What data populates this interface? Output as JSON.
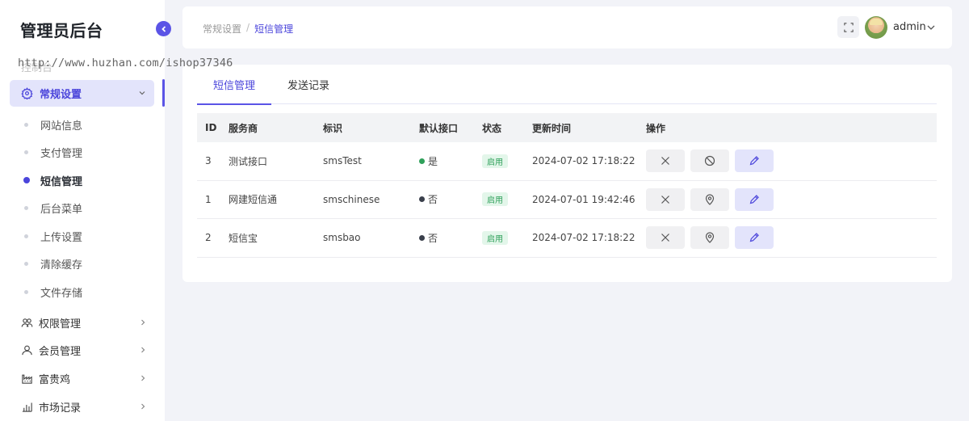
{
  "app": {
    "title": "管理员后台"
  },
  "watermark": "http://www.huzhan.com/ishop37346",
  "sidebar": {
    "ghost_item": "控制台",
    "active_group": {
      "label": "常规设置",
      "icon": "gear-icon"
    },
    "submenu": [
      {
        "label": "网站信息",
        "active": false
      },
      {
        "label": "支付管理",
        "active": false
      },
      {
        "label": "短信管理",
        "active": true
      },
      {
        "label": "后台菜单",
        "active": false
      },
      {
        "label": "上传设置",
        "active": false
      },
      {
        "label": "清除缓存",
        "active": false
      },
      {
        "label": "文件存储",
        "active": false
      }
    ],
    "groups": [
      {
        "label": "权限管理",
        "icon": "users-icon"
      },
      {
        "label": "会员管理",
        "icon": "user-icon"
      },
      {
        "label": "富贵鸡",
        "icon": "factory-icon"
      },
      {
        "label": "市场记录",
        "icon": "bar-chart-icon"
      }
    ]
  },
  "header": {
    "breadcrumb": [
      "常规设置",
      "短信管理"
    ],
    "breadcrumb_sep": "/",
    "username": "admin"
  },
  "tabs": [
    {
      "label": "短信管理",
      "active": true
    },
    {
      "label": "发送记录",
      "active": false
    }
  ],
  "table": {
    "columns": [
      "ID",
      "服务商",
      "标识",
      "默认接口",
      "状态",
      "更新时间",
      "操作"
    ],
    "rows": [
      {
        "id": "3",
        "provider": "测试接口",
        "tag": "smsTest",
        "default": "是",
        "default_color": "#2fa05a",
        "status": "启用",
        "updated": "2024-07-02 17:18:22",
        "mid_icon": "ban-icon"
      },
      {
        "id": "1",
        "provider": "网建短信通",
        "tag": "smschinese",
        "default": "否",
        "default_color": "#3a3f4b",
        "status": "启用",
        "updated": "2024-07-01 19:42:46",
        "mid_icon": "location-icon"
      },
      {
        "id": "2",
        "provider": "短信宝",
        "tag": "smsbao",
        "default": "否",
        "default_color": "#3a3f4b",
        "status": "启用",
        "updated": "2024-07-02 17:18:22",
        "mid_icon": "location-icon"
      }
    ]
  },
  "colors": {
    "accent": "#5b54e6",
    "active_bg": "#e3e4fb",
    "success": "#2fa05a"
  }
}
